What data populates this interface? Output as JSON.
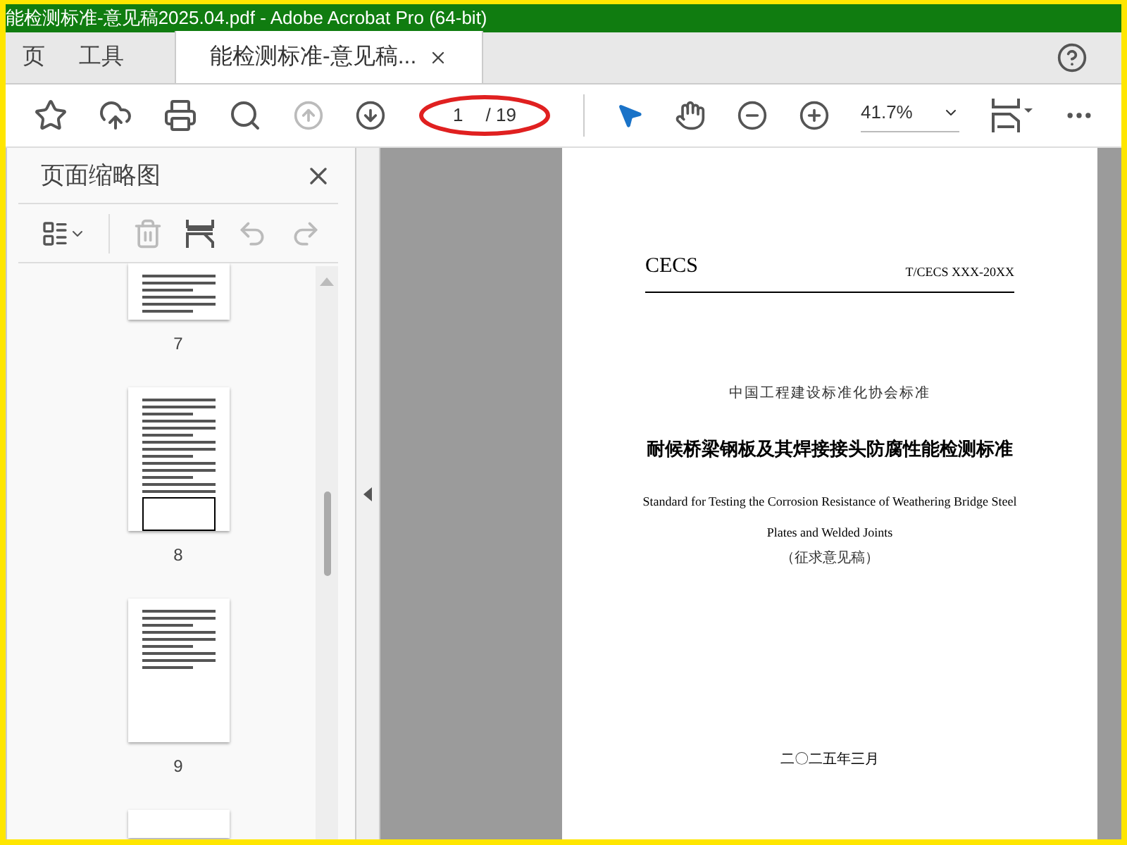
{
  "window": {
    "title": "能检测标准-意见稿2025.04.pdf - Adobe Acrobat Pro (64-bit)"
  },
  "tabs": [
    {
      "label": "页",
      "selected": false
    },
    {
      "label": "工具",
      "selected": false
    },
    {
      "label": "能检测标准-意见稿...",
      "selected": true
    }
  ],
  "toolbar": {
    "page_number": "1",
    "page_total": "/ 19",
    "zoom": "41.7%",
    "tools": [
      {
        "kind": "select",
        "selected": true
      },
      {
        "kind": "hand",
        "selected": false
      }
    ]
  },
  "sidebar": {
    "title": "页面缩略图",
    "thumbnails": [
      {
        "label": "7"
      },
      {
        "label": "8"
      },
      {
        "label": "9"
      }
    ]
  },
  "document": {
    "header_left": "CECS",
    "header_right": "T/CECS XXX-20XX",
    "org": "中国工程建设标准化协会标准",
    "title": "耐候桥梁钢板及其焊接接头防腐性能检测标准",
    "english_lines": [
      "Standard for Testing the Corrosion Resistance of Weathering Bridge Steel",
      "Plates and Welded Joints"
    ],
    "draft": "（征求意见稿）",
    "date": "二〇二五年三月"
  }
}
